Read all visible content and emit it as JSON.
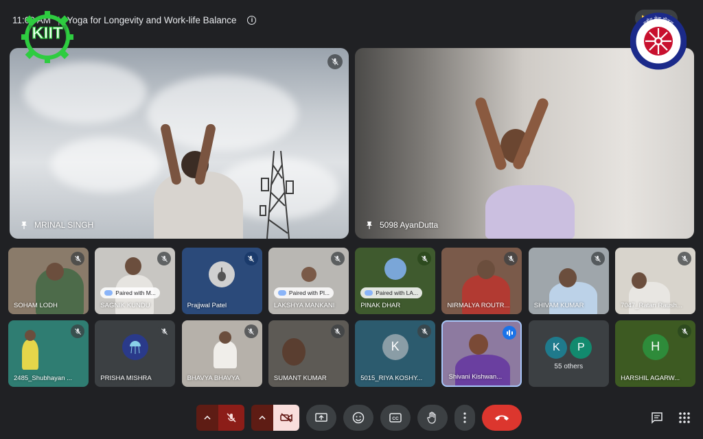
{
  "meeting": {
    "time": "11:00 AM",
    "separator": "|",
    "title": "Yoga for Longevity and Work-life Balance",
    "participant_count": "72"
  },
  "logos": {
    "left": {
      "text": "KIIT",
      "color": "#2ecc40"
    },
    "right": {
      "text": "NATIONAL SERVICE SCHEME",
      "top_text": "राष्ट्रीय सेवा योजना",
      "color": "#1b2a8a",
      "accent": "#c8102e"
    }
  },
  "featured": [
    {
      "name": "MRINAL SINGH",
      "pinned": true,
      "muted": true
    },
    {
      "name": "5098 AyanDutta",
      "pinned": true,
      "muted": true
    }
  ],
  "grid": [
    {
      "name": "SOHAM LODH",
      "bg": "#8a7b6a"
    },
    {
      "name": "SAGNIK KUNDU",
      "bg": "#c8c6c2",
      "paired": "Paired with M..."
    },
    {
      "name": "Prajjwal Patel",
      "bg": "#2b4a7a"
    },
    {
      "name": "LAKSHYA MANKANI",
      "bg": "#b9b7b3",
      "paired": "Paired with Pl..."
    },
    {
      "name": "PINAK DHAR",
      "bg": "#3f5a2e",
      "paired": "Paired with LA..."
    },
    {
      "name": "NIRMALYA ROUTR...",
      "bg": "#7a5a4a"
    },
    {
      "name": "SHIVAM KUMAR",
      "bg": "#9fa6ab"
    },
    {
      "name": "7047_Ratan Raush...",
      "bg": "#d8d4cc"
    },
    {
      "name": "2485_Shubhayan ...",
      "bg": "#2f7d72"
    },
    {
      "name": "PRISHA MISHRA",
      "bg": "#3c4043"
    },
    {
      "name": "BHAVYA BHAVYA",
      "bg": "#b6b1aa"
    },
    {
      "name": "SUMANT KUMAR",
      "bg": "#5d5a55"
    },
    {
      "name": "5015_RIYA KOSHY...",
      "bg": "#2c5b6e",
      "initial": "K"
    },
    {
      "name": "Shivani Kishwan...",
      "bg": "#8d7aa0"
    },
    {
      "name": "HARSHIL AGARW...",
      "bg": "#3d5a22",
      "initial": "H"
    }
  ],
  "others": {
    "label": "55 others",
    "avatars": [
      "K",
      "P"
    ]
  },
  "colors": {
    "background": "#202124",
    "end_call": "#dc362e",
    "mic_off": "#8c1d18",
    "cam_off": "#f9dedc"
  }
}
